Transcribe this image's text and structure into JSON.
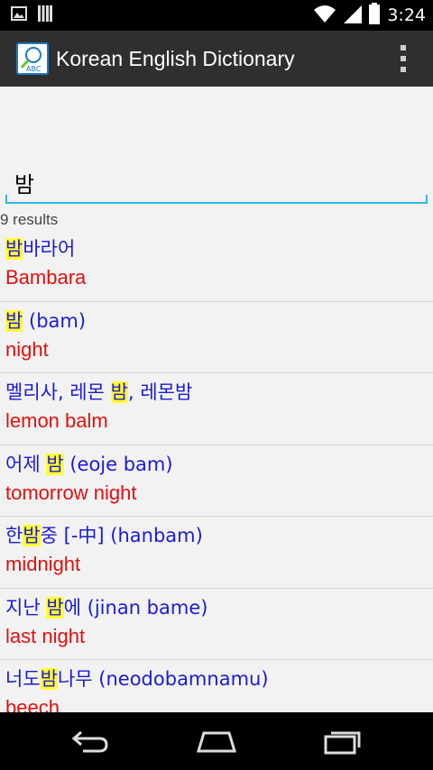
{
  "status_bar": {
    "time": "3:24",
    "icons": [
      "image-icon",
      "signal-bars-icon",
      "wifi-icon",
      "cell-signal-icon",
      "battery-icon"
    ]
  },
  "action_bar": {
    "title": "Korean English Dictionary",
    "app_icon_label": "ABC",
    "overflow_icon": "overflow-menu-icon"
  },
  "search": {
    "value": "밤",
    "accent_color": "#33b5e5"
  },
  "result_count": "9 results",
  "results": [
    {
      "pre": "",
      "hl": "밤",
      "post": "바라어",
      "eng": "Bambara"
    },
    {
      "pre": "",
      "hl": "밤",
      "post": " (bam)",
      "eng": "night"
    },
    {
      "pre": "멜리사, 레몬 ",
      "hl": "밤",
      "post": ", 레몬밤",
      "eng": "lemon balm"
    },
    {
      "pre": "어제 ",
      "hl": "밤",
      "post": " (eoje bam)",
      "eng": "tomorrow night"
    },
    {
      "pre": "한",
      "hl": "밤",
      "post": "중 [-中] (hanbam)",
      "eng": "midnight"
    },
    {
      "pre": "지난 ",
      "hl": "밤",
      "post": "에 (jinan bame)",
      "eng": "last night"
    },
    {
      "pre": "너도",
      "hl": "밤",
      "post": "나무 (neodobamnamu)",
      "eng": "beech"
    }
  ],
  "colors": {
    "korean_text": "#1b1bd6",
    "english_text": "#e01010",
    "highlight": "#ffff33",
    "action_bar": "#2f2f2f"
  },
  "nav": {
    "back_icon": "back-icon",
    "home_icon": "home-icon",
    "recents_icon": "recents-icon"
  }
}
